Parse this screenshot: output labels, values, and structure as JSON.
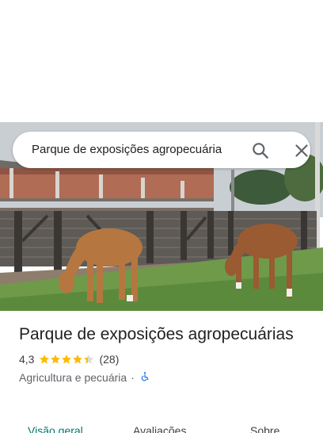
{
  "search": {
    "query": "Parque de exposições agropecuária",
    "search_icon": "search-icon",
    "close_icon": "close-icon"
  },
  "hero_photo": "horses-grazing-photo",
  "place": {
    "title": "Parque de exposições agropecuárias",
    "rating": "4,3",
    "stars": 4.3,
    "review_count": "(28)",
    "category": "Agricultura e pecuária",
    "separator": "·",
    "accessibility_icon": "wheelchair-icon"
  },
  "tabs": [
    {
      "label": "Visão geral",
      "active": true
    },
    {
      "label": "Avaliações",
      "active": false
    },
    {
      "label": "Sobre",
      "active": false
    }
  ],
  "colors": {
    "accent": "#00796b",
    "star": "#fbbc04",
    "accessibility": "#1a73e8"
  }
}
